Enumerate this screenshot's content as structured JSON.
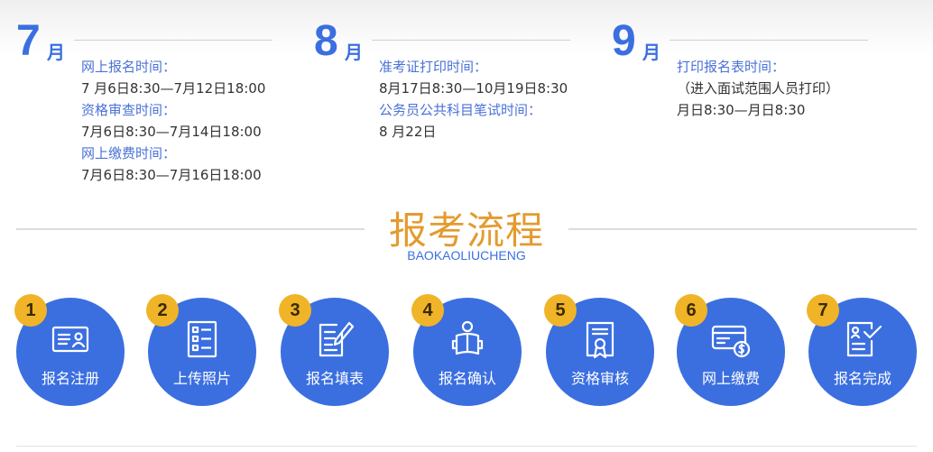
{
  "months": [
    {
      "num": "7",
      "unit": "月",
      "items": [
        {
          "label": "网上报名时间：",
          "value": "7 月6日8:30—7月12日18:00"
        },
        {
          "label": "资格审查时间：",
          "value": "7月6日8:30—7月14日18:00"
        },
        {
          "label": "网上缴费时间：",
          "value": "7月6日8:30—7月16日18:00"
        }
      ]
    },
    {
      "num": "8",
      "unit": "月",
      "items": [
        {
          "label": "准考证打印时间：",
          "value": "8月17日8:30—10月19日8:30"
        },
        {
          "label": "公务员公共科目笔试时间：",
          "value": "8 月22日"
        }
      ]
    },
    {
      "num": "9",
      "unit": "月",
      "items": [
        {
          "label": "打印报名表时间：",
          "value": "（进入面试范围人员打印）"
        },
        {
          "label": "",
          "value": "月日8:30—月日8:30"
        }
      ]
    }
  ],
  "section": {
    "title": "报考流程",
    "subtitle": "BAOKAOLIUCHENG"
  },
  "steps": [
    {
      "n": "1",
      "label": "报名注册",
      "icon": "id-card-icon"
    },
    {
      "n": "2",
      "label": "上传照片",
      "icon": "photo-form-icon"
    },
    {
      "n": "3",
      "label": "报名填表",
      "icon": "fill-form-icon"
    },
    {
      "n": "4",
      "label": "报名确认",
      "icon": "reading-person-icon"
    },
    {
      "n": "5",
      "label": "资格审核",
      "icon": "certificate-icon"
    },
    {
      "n": "6",
      "label": "网上缴费",
      "icon": "card-payment-icon"
    },
    {
      "n": "7",
      "label": "报名完成",
      "icon": "checked-document-icon"
    }
  ],
  "colors": {
    "accent": "#3b6fe0",
    "badge": "#f0b428",
    "title": "#e39b2f"
  }
}
